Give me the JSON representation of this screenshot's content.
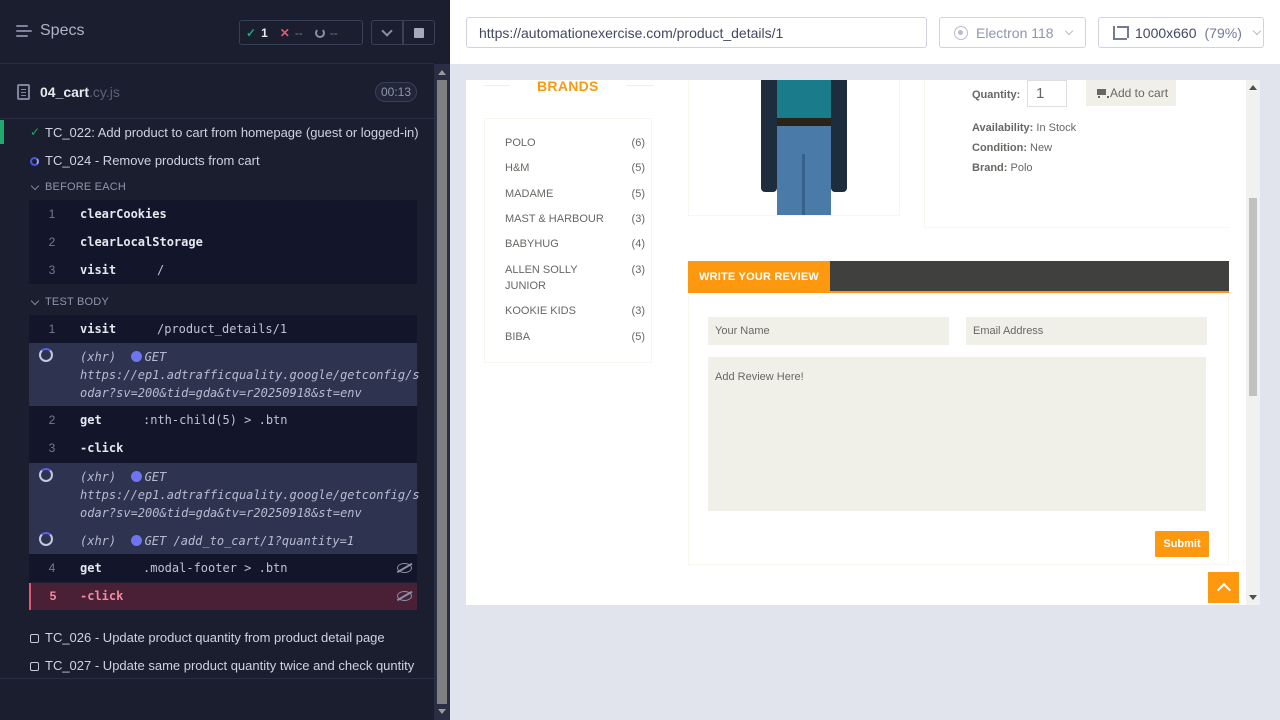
{
  "reporter": {
    "specs_label": "Specs",
    "stats": {
      "passed": "1",
      "failed": "--",
      "pending": "--"
    },
    "file": {
      "name": "04_cart",
      "ext": ".cy.js",
      "duration": "00:13"
    },
    "tests": [
      {
        "title": "TC_022: Add product to cart from homepage (guest or logged-in)",
        "state": "passed"
      },
      {
        "title": "TC_024 - Remove products from cart",
        "state": "running"
      },
      {
        "title": "TC_026 - Update product quantity from product detail page",
        "state": "pending"
      },
      {
        "title": "TC_027 - Update same product quantity twice and check quntity",
        "state": "pending"
      }
    ],
    "before_each": {
      "label": "BEFORE EACH",
      "commands": [
        {
          "num": "1",
          "name": "clearCookies",
          "arg": ""
        },
        {
          "num": "2",
          "name": "clearLocalStorage",
          "arg": ""
        },
        {
          "num": "3",
          "name": "visit",
          "arg": "/"
        }
      ]
    },
    "test_body": {
      "label": "TEST BODY",
      "cmd1": {
        "num": "1",
        "name": "visit",
        "arg": "/product_details/1"
      },
      "xhr1": {
        "prefix": "(xhr)",
        "method": "GET",
        "line2": "https://ep1.adtrafficquality.google/getconfig/s",
        "line3": "odar?sv=200&tid=gda&tv=r20250918&st=env"
      },
      "cmd2": {
        "num": "2",
        "name": "get",
        "arg": ":nth-child(5) > .btn"
      },
      "cmd3": {
        "num": "3",
        "name": "-click",
        "arg": ""
      },
      "xhr2": {
        "prefix": "(xhr)",
        "method": "GET",
        "line2": "https://ep1.adtrafficquality.google/getconfig/s",
        "line3": "odar?sv=200&tid=gda&tv=r20250918&st=env"
      },
      "xhr3": {
        "prefix": "(xhr)",
        "method": "GET /add_to_cart/1?quantity=1"
      },
      "cmd4": {
        "num": "4",
        "name": "get",
        "arg": ".modal-footer > .btn"
      },
      "cmd5": {
        "num": "5",
        "name": "-click",
        "arg": ""
      }
    }
  },
  "aut": {
    "url": "https://automationexercise.com/product_details/1",
    "browser": "Electron 118",
    "viewport": "1000x660",
    "zoom": "(79%)"
  },
  "site": {
    "brands_title": "BRANDS",
    "brands": [
      {
        "name": "POLO",
        "count": "(6)"
      },
      {
        "name": "H&M",
        "count": "(5)"
      },
      {
        "name": "MADAME",
        "count": "(5)"
      },
      {
        "name": "MAST & HARBOUR",
        "count": "(3)"
      },
      {
        "name": "BABYHUG",
        "count": "(4)"
      },
      {
        "name": "ALLEN SOLLY JUNIOR",
        "count": "(3)"
      },
      {
        "name": "KOOKIE KIDS",
        "count": "(3)"
      },
      {
        "name": "BIBA",
        "count": "(5)"
      }
    ],
    "quantity_label": "Quantity:",
    "quantity_value": "1",
    "add_to_cart": "Add to cart",
    "availability_label": "Availability:",
    "availability_value": "In Stock",
    "condition_label": "Condition:",
    "condition_value": "New",
    "brand_label": "Brand:",
    "brand_value": "Polo",
    "review_tab": "WRITE YOUR REVIEW",
    "name_placeholder": "Your Name",
    "email_placeholder": "Email Address",
    "review_placeholder": "Add Review Here!",
    "submit": "Submit"
  },
  "colors": {
    "accent": "#fe980f",
    "pass": "#1fa971",
    "fail": "#e45770",
    "running": "#4956e3"
  }
}
